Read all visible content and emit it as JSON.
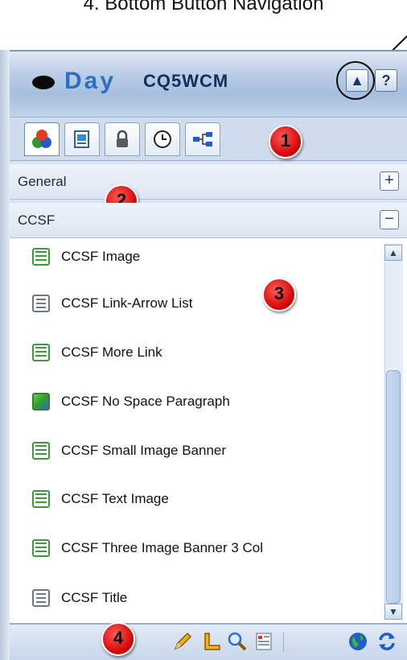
{
  "caption": "4. Bottom Button Navigation",
  "header": {
    "logo_day": "Day",
    "logo_cq5": "CQ5WCM",
    "collapse_label": "▲",
    "help_label": "?"
  },
  "tabs": [
    {
      "icon": "components-icon"
    },
    {
      "icon": "page-icon"
    },
    {
      "icon": "lock-icon"
    },
    {
      "icon": "clock-icon"
    },
    {
      "icon": "workflow-icon"
    }
  ],
  "badges": [
    "1",
    "2",
    "3",
    "4"
  ],
  "groups": {
    "general": {
      "label": "General",
      "toggle": "+"
    },
    "ccsf": {
      "label": "CCSF",
      "toggle": "−"
    }
  },
  "components": [
    {
      "label": "CCSF Image",
      "icon": "grid"
    },
    {
      "label": "CCSF Link-Arrow List",
      "icon": "doc"
    },
    {
      "label": "CCSF More Link",
      "icon": "grid"
    },
    {
      "label": "CCSF No Space Paragraph",
      "icon": "img"
    },
    {
      "label": "CCSF Small Image Banner",
      "icon": "grid"
    },
    {
      "label": "CCSF Text Image",
      "icon": "grid"
    },
    {
      "label": "CCSF Three Image Banner 3 Col",
      "icon": "grid"
    },
    {
      "label": "CCSF Title",
      "icon": "doc"
    }
  ],
  "bottom_buttons": [
    "edit-icon",
    "design-icon",
    "preview-icon",
    "scaffolding-icon",
    "website-icon",
    "refresh-icon"
  ],
  "colors": {
    "accent": "#2d6fc1",
    "badge": "#d10000",
    "panel": "#d9e4f2"
  }
}
